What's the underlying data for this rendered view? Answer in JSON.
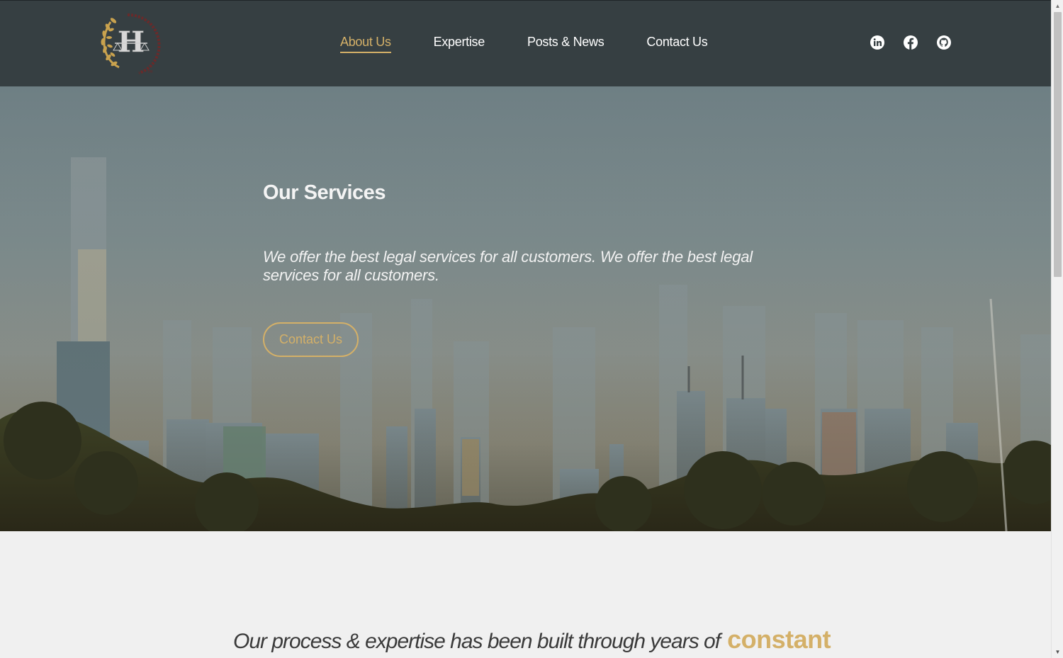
{
  "header": {
    "nav": [
      {
        "label": "About Us",
        "active": true
      },
      {
        "label": "Expertise",
        "active": false
      },
      {
        "label": "Posts & News",
        "active": false
      },
      {
        "label": "Contact Us",
        "active": false
      }
    ],
    "social": [
      "linkedin-icon",
      "facebook-icon",
      "github-icon"
    ]
  },
  "hero": {
    "title": "Our Services",
    "text": "We offer the best legal services for all customers. We offer the best legal services for all customers.",
    "button_label": "Contact Us"
  },
  "tagline": {
    "text": "Our process & expertise has been built through years of",
    "accent": "constant"
  },
  "colors": {
    "header_bg": "#363f42",
    "accent": "#d4b068",
    "page_bg": "#f0f0f0"
  }
}
